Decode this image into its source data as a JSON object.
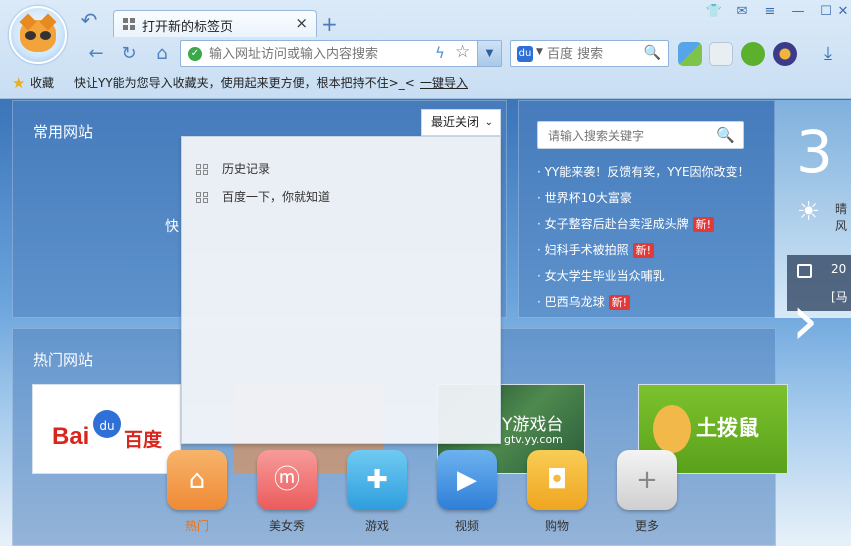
{
  "browser": {
    "tab_title": "打开新的标签页",
    "tab_close": "×",
    "new_tab": "+",
    "address_placeholder": "输入网址访问或输入内容搜索",
    "search_engine": "百度",
    "search_placeholder": "百度 搜索"
  },
  "bookmarks": {
    "label": "收藏",
    "tip": "快让YY能为您导入收藏夹，使用起来更方便，根本把持不住>_<",
    "import_link": "一键导入"
  },
  "common_sites": {
    "title": "常用网站",
    "fragment": "快",
    "recent_button": "最近关闭",
    "recent_items": [
      "历史记录",
      "百度一下，你就知道"
    ]
  },
  "news": {
    "search_placeholder": "请输入搜索关键字",
    "items": [
      {
        "text": "· YY能来袭！反馈有奖，YYE因你改变！",
        "badge": ""
      },
      {
        "text": "· 世界杯10大富豪",
        "badge": ""
      },
      {
        "text": "· 女子整容后赴台卖淫成头牌",
        "badge": "新!"
      },
      {
        "text": "· 妇科手术被拍照",
        "badge": "新!"
      },
      {
        "text": "· 女大学生毕业当众哺乳",
        "badge": ""
      },
      {
        "text": "· 巴西乌龙球",
        "badge": "新!"
      }
    ]
  },
  "weather": {
    "temp": "3",
    "line1": "晴",
    "line2": "风",
    "date": "20",
    "sub": "[马"
  },
  "hot_sites": {
    "title": "热门网站",
    "baidu_text": "Bai",
    "baidu_du": "du",
    "baidu_cn": "百度",
    "yy_title": "Y游戏台",
    "yy_url": "gtv.yy.com",
    "tubo_title": "土拨鼠"
  },
  "dock": [
    {
      "label": "热门",
      "icon": "home-icon",
      "color": "#f39a45"
    },
    {
      "label": "美女秀",
      "icon": "meinvxiu-icon",
      "color": "#f06a6a"
    },
    {
      "label": "游戏",
      "icon": "gamepad-icon",
      "color": "#3eaee6"
    },
    {
      "label": "视频",
      "icon": "play-icon",
      "color": "#3b8fe0"
    },
    {
      "label": "购物",
      "icon": "shopping-bag-icon",
      "color": "#f3b330"
    },
    {
      "label": "更多",
      "icon": "plus-icon",
      "color": "#d9d9d9"
    }
  ],
  "colors": {
    "accent": "#3f79bd",
    "new_badge": "#e23a3a",
    "active_dock": "#e6731a"
  }
}
